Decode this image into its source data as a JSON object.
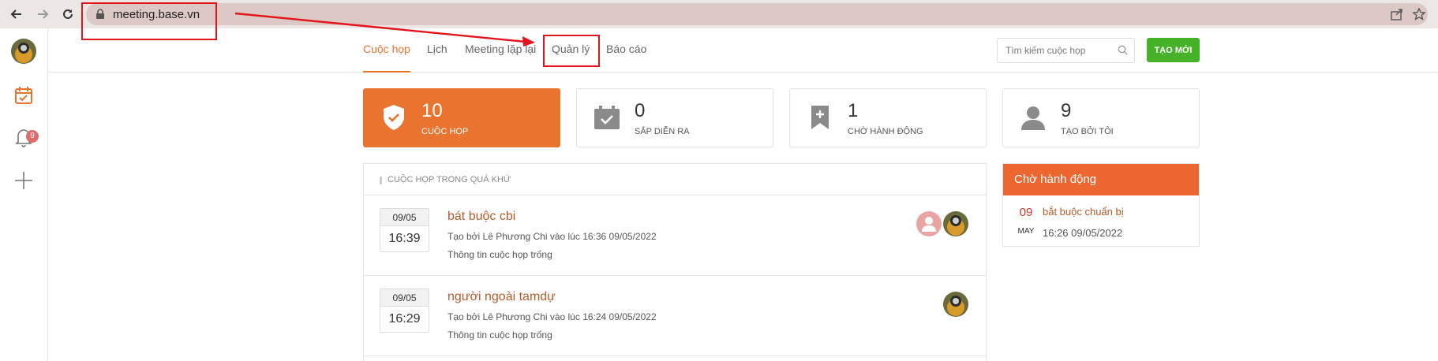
{
  "browser": {
    "url": "meeting.base.vn"
  },
  "rail": {
    "notification_count": "9"
  },
  "nav": {
    "tabs": [
      {
        "label": "Cuộc họp",
        "active": true
      },
      {
        "label": "Lịch",
        "active": false
      },
      {
        "label": "Meeting lặp lại",
        "active": false
      },
      {
        "label": "Quản lý",
        "active": false
      },
      {
        "label": "Báo cáo",
        "active": false
      }
    ],
    "search_placeholder": "Tìm kiếm cuộc họp",
    "new_button_label": "TẠO MỚI"
  },
  "stats": [
    {
      "count": "10",
      "label": "CUỘC HỌP",
      "icon": "shield-check-icon",
      "active": true
    },
    {
      "count": "0",
      "label": "SẮP DIỄN RA",
      "icon": "calendar-check-icon",
      "active": false
    },
    {
      "count": "1",
      "label": "CHỜ HÀNH ĐỘNG",
      "icon": "bookmark-plus-icon",
      "active": false
    },
    {
      "count": "9",
      "label": "TẠO BỞI TÔI",
      "icon": "user-icon",
      "active": false
    }
  ],
  "past_meetings": {
    "heading": "CUỘC HỌP TRONG QUÁ KHỨ",
    "items": [
      {
        "date": "09/05",
        "time": "16:39",
        "title": "bát buộc cbi",
        "meta": "Tạo bởi Lê Phương Chi vào lúc 16:36 09/05/2022",
        "desc": "Thông tin cuộc họp trống"
      },
      {
        "date": "09/05",
        "time": "16:29",
        "title": "người ngoài tamdự",
        "meta": "Tạo bởi Lê Phương Chi vào lúc 16:24 09/05/2022",
        "desc": "Thông tin cuộc họp trống"
      }
    ]
  },
  "pending": {
    "heading": "Chờ hành động",
    "item": {
      "day": "09",
      "month": "MAY",
      "title": "bắt buộc chuẩn bị",
      "time": "16:26 09/05/2022"
    }
  },
  "colors": {
    "accent": "#e8742f",
    "panel_header": "#ec6630",
    "new_button": "#45b227",
    "annotation": "#e3141c"
  }
}
